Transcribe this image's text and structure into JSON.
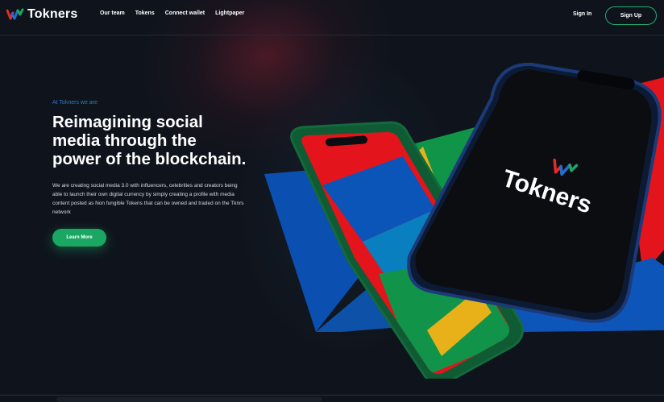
{
  "header": {
    "brand": "Tokners",
    "nav": [
      "Our team",
      "Tokens",
      "Connect wallet",
      "Lightpaper"
    ],
    "sign_in": "Sign In",
    "sign_up": "Sign Up"
  },
  "hero": {
    "eyebrow": "At Tokners we are",
    "title_lines": [
      "Reimagining social",
      "media through the",
      "power of the blockchain."
    ],
    "description": "We are creating social media 3.0 with influencers, celebrities and creators being able to launch their own digital currency by simply creating a profile with media content posted as Non fungible Tokens that can be owned and traded on the Tknrs network",
    "cta": "Learn More"
  },
  "phone_screen": {
    "brand": "Tokners"
  },
  "colors": {
    "accent_green": "#1aa763",
    "eyebrow_blue": "#2e78c7",
    "background": "#0f141c"
  },
  "icons": [
    "tokners-logo-icon"
  ]
}
